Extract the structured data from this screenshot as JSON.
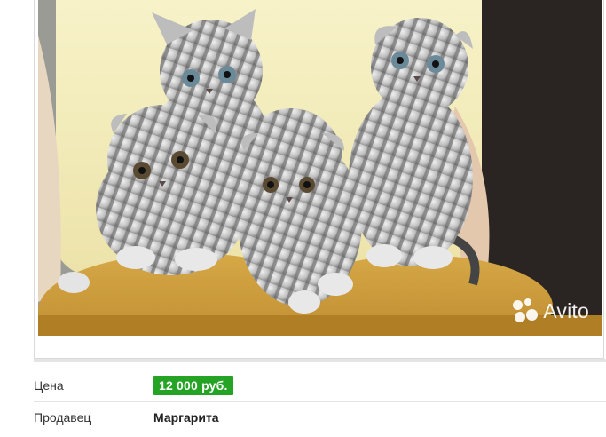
{
  "listing": {
    "photo": {
      "alt_icon": "kittens-photo",
      "watermark_text": "Avito"
    },
    "price_label": "Цена",
    "price_value": "12 000 руб.",
    "seller_label": "Продавец",
    "seller_name": "Маргарита"
  },
  "colors": {
    "price_badge": "#24a324",
    "shirt": "#f4efc0",
    "trousers": "#c99a3a"
  }
}
